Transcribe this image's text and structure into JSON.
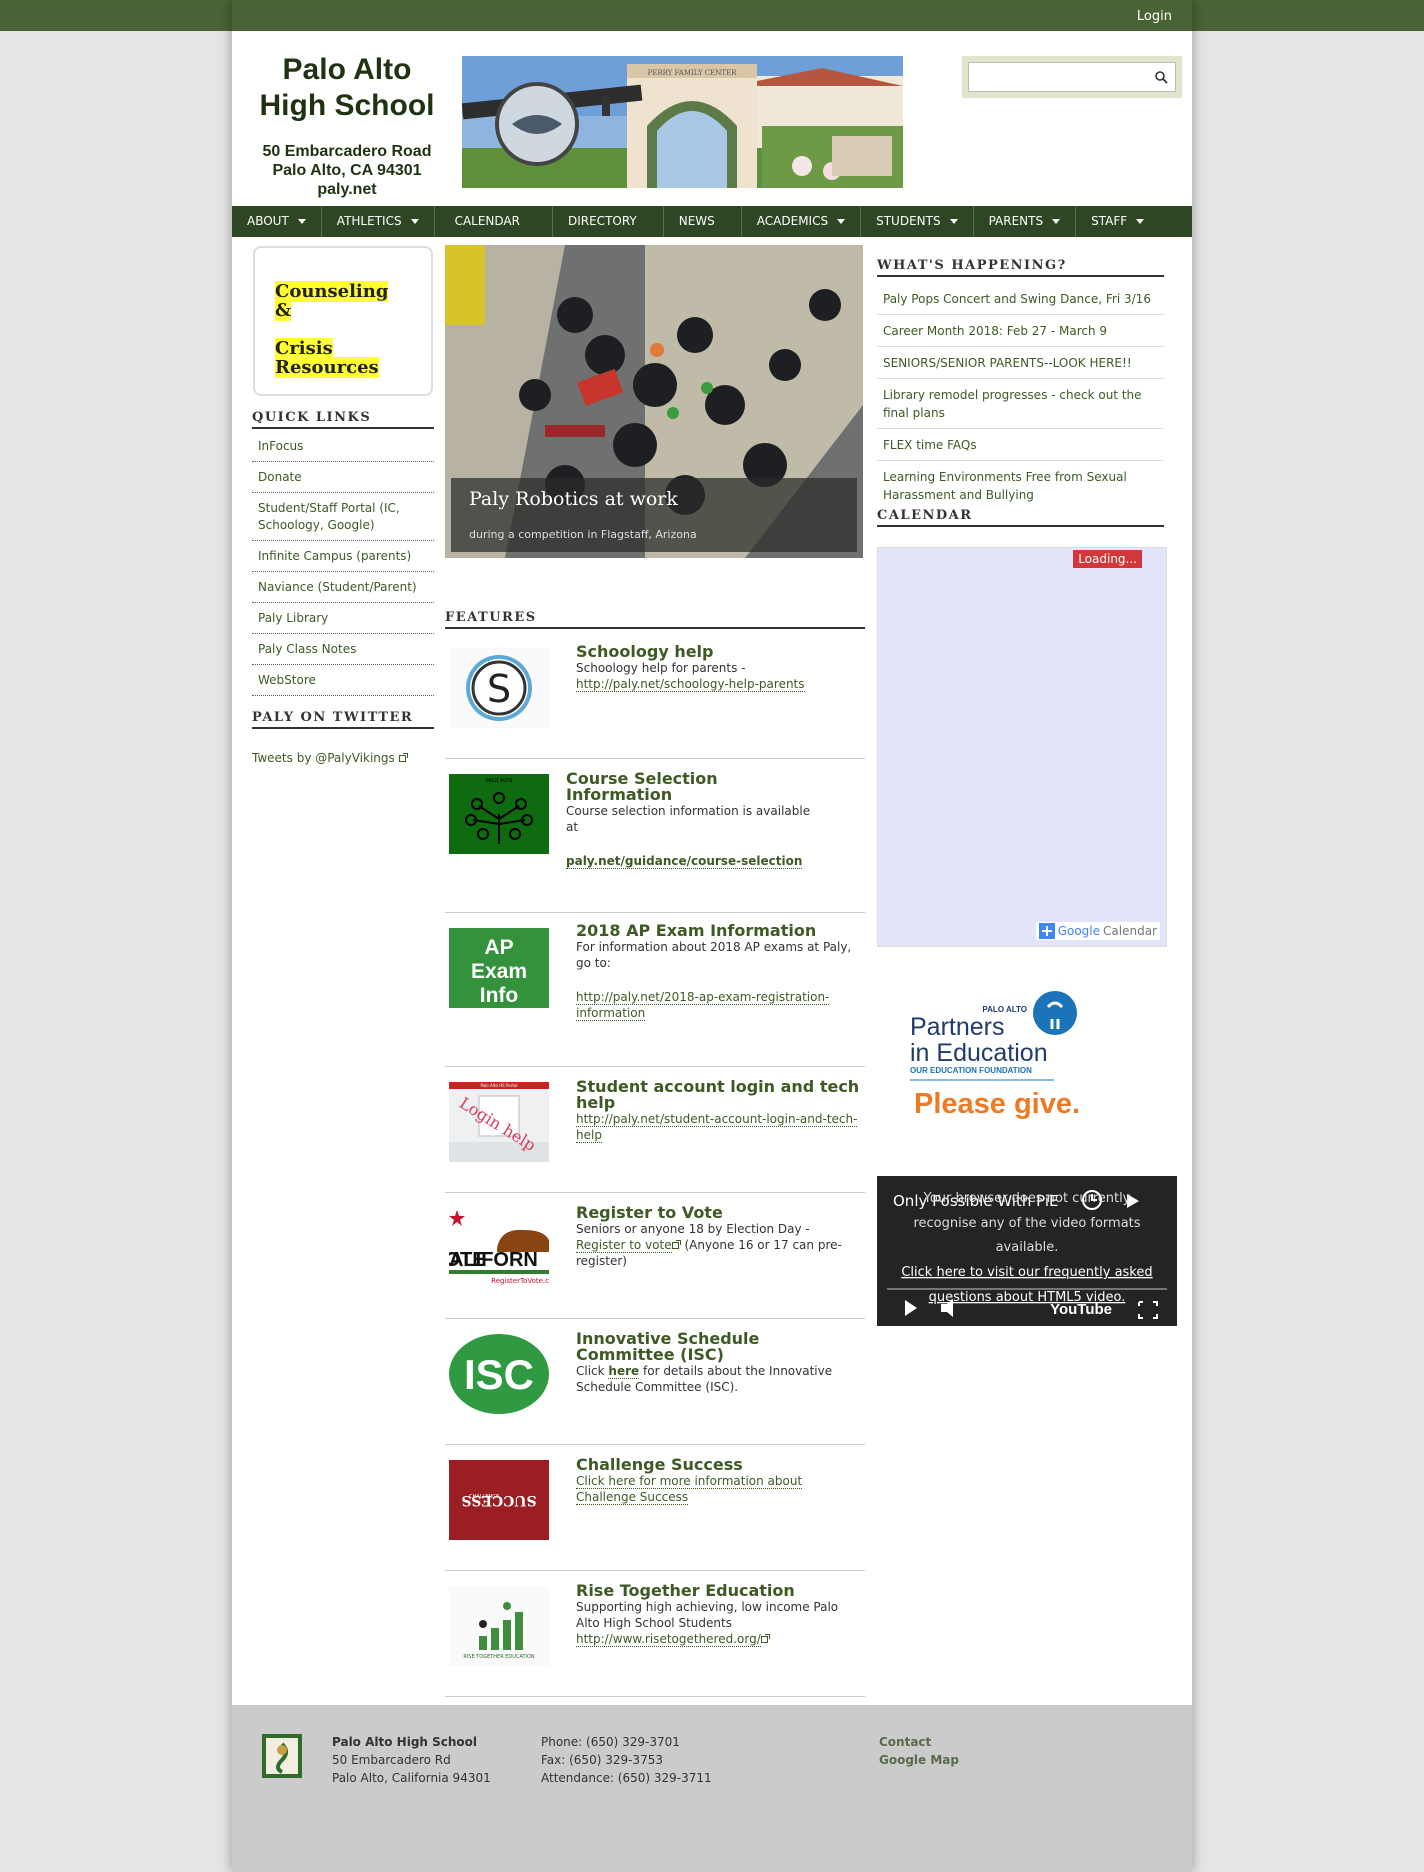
{
  "header": {
    "login_label": "Login",
    "school_name_line1": "Palo Alto",
    "school_name_line2": "High School",
    "address_line1": "50 Embarcadero Road",
    "address_line2": "Palo Alto, CA 94301",
    "website": "paly.net",
    "banner_sign_text": "PERRY FAMILY CENTER",
    "search_placeholder": ""
  },
  "nav": [
    {
      "label": "ABOUT",
      "has_menu": true
    },
    {
      "label": "ATHLETICS",
      "has_menu": true
    },
    {
      "label": "CALENDAR",
      "has_menu": false
    },
    {
      "label": "DIRECTORY",
      "has_menu": false
    },
    {
      "label": "NEWS",
      "has_menu": false
    },
    {
      "label": "ACADEMICS",
      "has_menu": true
    },
    {
      "label": "STUDENTS",
      "has_menu": true
    },
    {
      "label": "PARENTS",
      "has_menu": true
    },
    {
      "label": "STAFF",
      "has_menu": true
    }
  ],
  "sidebar": {
    "counseling_line1": "Counseling",
    "counseling_line2": "&",
    "counseling_line3": "Crisis",
    "counseling_line4": "Resources",
    "quick_links_heading": "QUICK LINKS",
    "quick_links": [
      "InFocus",
      "Donate",
      "Student/Staff Portal (IC, Schoology, Google)",
      "Infinite Campus (parents)",
      "Naviance (Student/Parent)",
      "Paly Library",
      "Paly Class Notes",
      "WebStore"
    ],
    "twitter_heading": "PALY ON TWITTER",
    "twitter_link": "Tweets by @PalyVikings"
  },
  "slideshow": {
    "title": "Paly Robotics at work",
    "subtitle": "during a competition in Flagstaff, Arizona"
  },
  "features": {
    "heading": "FEATURES",
    "items": [
      {
        "title": "Schoology help",
        "text": "Schoology help for parents -",
        "link": "http://paly.net/schoology-help-parents"
      },
      {
        "title_line1": "Course Selection",
        "title_line2": "Information",
        "text_line1": "Course selection information is available",
        "text_line2": "at",
        "link": "paly.net/guidance/course-selection",
        "thumb_title": "PALO ALTO"
      },
      {
        "title": "2018 AP Exam Information",
        "text_line1": "For information about 2018 AP exams at Paly,",
        "text_line2": "go to:",
        "link_line1": "http://paly.net/2018-ap-exam-registration-",
        "link_line2": "information",
        "thumb_line1": "AP",
        "thumb_line2": "Exam",
        "thumb_line3": "Info"
      },
      {
        "title_line1": "Student account login and tech",
        "title_line2": "help",
        "link_line1": "http://paly.net/student-account-login-and-tech-",
        "link_line2": "help",
        "thumb_text": "Login help",
        "thumb_header": "Palo Alto HS Portal"
      },
      {
        "title": "Register to Vote",
        "text": "Seniors or anyone 18 by Election Day -",
        "link": "Register to vote",
        "text_after": "(Anyone 16 or 17 can pre-",
        "text_after2": "register)",
        "thumb_line1": "OTE",
        "thumb_line2": "ALIFORN",
        "thumb_line3": "RegisterToVote.c"
      },
      {
        "title_line1": "Innovative Schedule",
        "title_line2": "Committee (ISC)",
        "text_prefix": "Click",
        "link": "here",
        "text_suffix": "for details about the Innovative",
        "text_line2": "Schedule Committee (ISC).",
        "thumb_text": "ISC"
      },
      {
        "title": "Challenge Success",
        "link_line1": "Click here for more information about",
        "link_line2": "Challenge Success",
        "thumb_line1": "CHALLENGE",
        "thumb_line2": "SUCCESS"
      },
      {
        "title": "Rise Together Education",
        "text_line1": "Supporting high achieving, low income Palo",
        "text_line2": "Alto High School Students",
        "link": "http://www.risetogethered.org/",
        "thumb_text": "RISE TOGETHER EDUCATION"
      }
    ]
  },
  "whats_happening": {
    "heading": "WHAT'S HAPPENING?",
    "items": [
      "Paly Pops Concert and Swing Dance, Fri 3/16",
      "Career Month 2018: Feb 27 - March 9",
      "SENIORS/SENIOR PARENTS--LOOK HERE!!",
      "Library remodel progresses - check out the final plans",
      "FLEX time FAQs",
      "Learning Environments Free from Sexual Harassment and Bullying"
    ]
  },
  "calendar": {
    "heading": "CALENDAR",
    "loading": "Loading...",
    "google": "Google",
    "calendar_word": "Calendar"
  },
  "pie_ad": {
    "palo_alto": "PALO ALTO",
    "partners": "Partners",
    "in_education": "in Education",
    "tagline": "OUR EDUCATION FOUNDATION",
    "please_give": "Please give."
  },
  "video": {
    "title": "Only Possible With PiE",
    "message_line1": "Your browser does not currently",
    "message_line2": "recognise any of the video formats",
    "message_line3": "available.",
    "link_line1": "Click here to visit our frequently asked",
    "link_line2": "questions about HTML5 video.",
    "youtube": "YouTube"
  },
  "footer": {
    "school": "Palo Alto High School",
    "address1": "50 Embarcadero Rd",
    "address2": "Palo Alto, California 94301",
    "phone": "Phone: (650) 329-3701",
    "fax": "Fax: (650) 329-3753",
    "attendance": "Attendance: (650) 329-3711",
    "contact": "Contact",
    "map": "Google Map"
  },
  "colors": {
    "nav_bg": "#2f4625",
    "top_bar": "#4a6334",
    "link_green": "#3e5a24",
    "highlight": "#ffff33",
    "loading_red": "#d4373a"
  }
}
